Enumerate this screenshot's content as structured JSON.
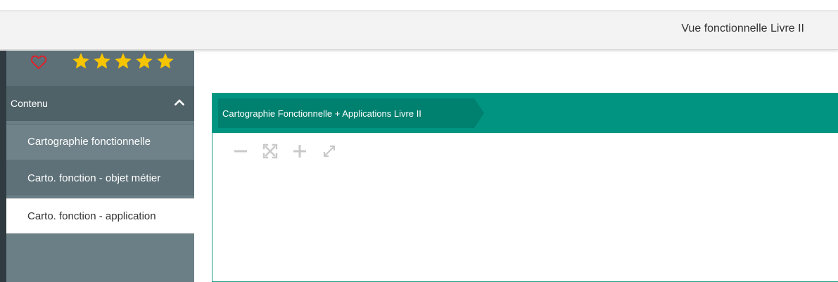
{
  "header": {
    "title": "Vue fonctionnelle Livre II"
  },
  "sidebar": {
    "rating": {
      "favorite_icon": "heart-outline-icon",
      "stars": 5,
      "star_icon": "star-icon",
      "star_color": "#f7c400",
      "heart_color": "#e0202a"
    },
    "section": {
      "label": "Contenu",
      "icon": "chevron-up-icon"
    },
    "items": [
      {
        "label": "Cartographie fonctionnelle"
      },
      {
        "label": "Carto. fonction - objet métier"
      },
      {
        "label": "Carto. fonction - application",
        "active": true
      }
    ]
  },
  "panel": {
    "breadcrumb": "Cartographie Fonctionnelle + Applications Livre II",
    "accent": "#009481",
    "tools": [
      "zoom-out-icon",
      "fit-to-screen-icon",
      "zoom-in-icon",
      "fullscreen-icon"
    ]
  }
}
